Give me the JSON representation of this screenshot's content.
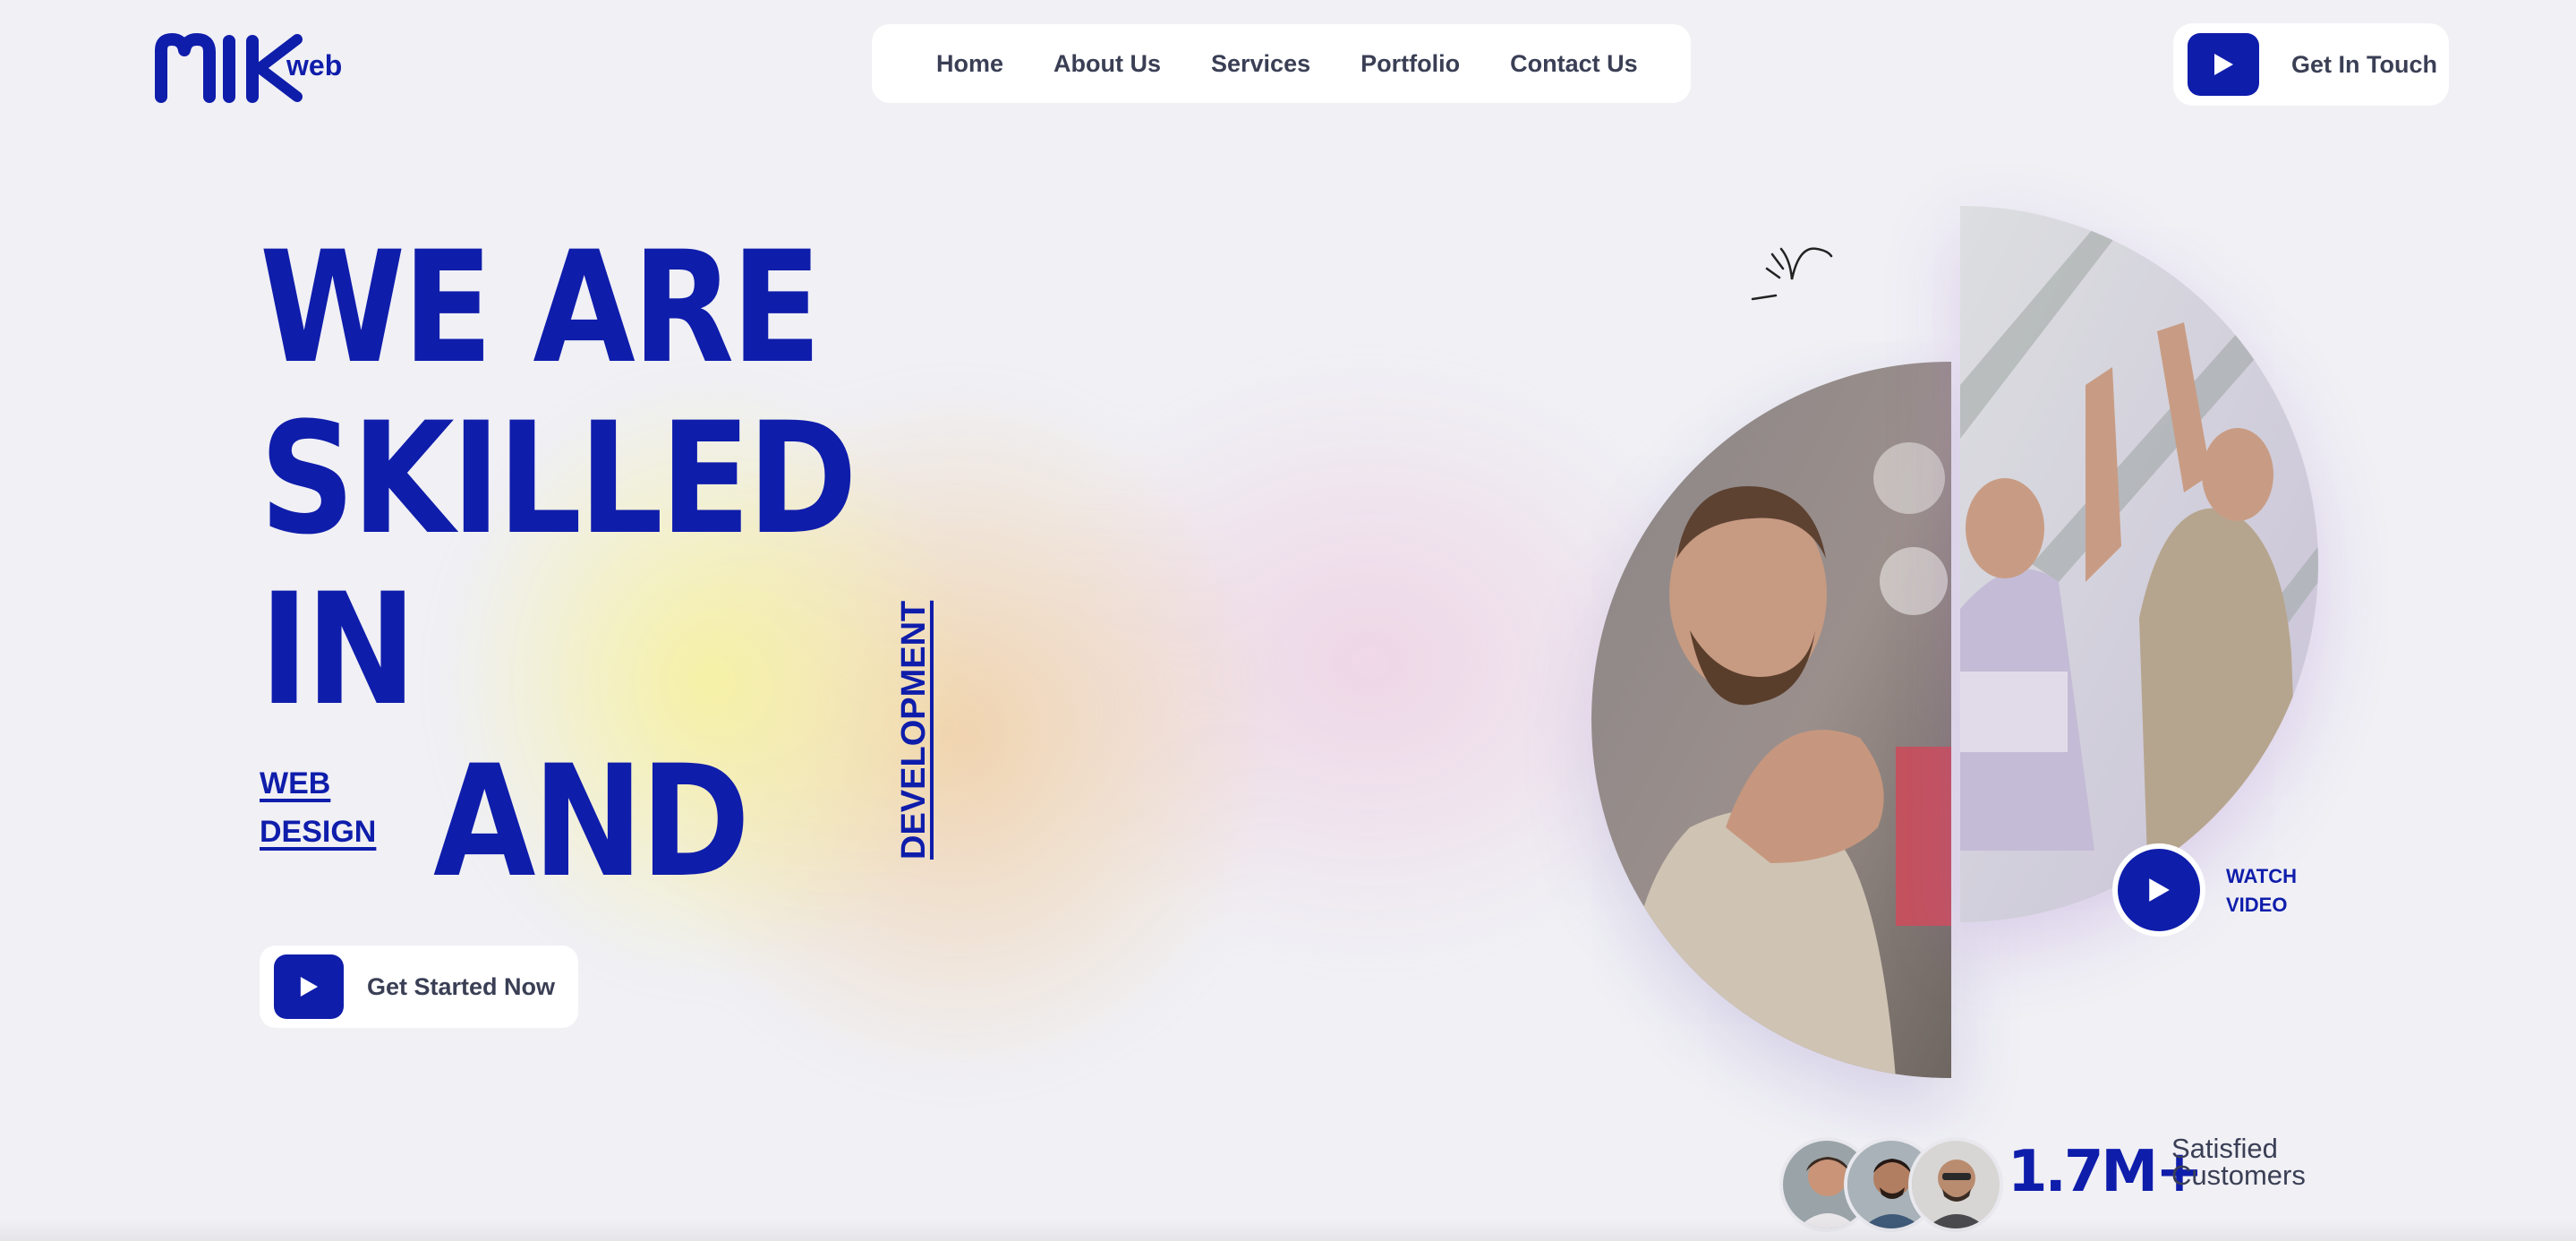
{
  "brand": {
    "logo_main": "MIK",
    "logo_sub": "web",
    "accent_color": "#0f1dab"
  },
  "nav": {
    "items": [
      {
        "label": "Home"
      },
      {
        "label": "About Us"
      },
      {
        "label": "Services"
      },
      {
        "label": "Portfolio"
      },
      {
        "label": "Contact Us"
      }
    ]
  },
  "header_cta": {
    "label": "Get In Touch",
    "icon": "play-icon"
  },
  "hero": {
    "line1": "WE ARE",
    "line2": "SKILLED",
    "line3": "IN",
    "web": "WEB",
    "design": "DESIGN",
    "and": "AND",
    "development": "DEVELOPMENT",
    "start_button": "Get Started Now"
  },
  "media": {
    "watch_line1": "WATCH",
    "watch_line2": "VIDEO",
    "left_image": "man-thinking-photo",
    "right_image": "team-high-five-photo"
  },
  "stats": {
    "value": "1.7M+",
    "label_line1": "Satisfied",
    "label_line2": "Customers"
  }
}
